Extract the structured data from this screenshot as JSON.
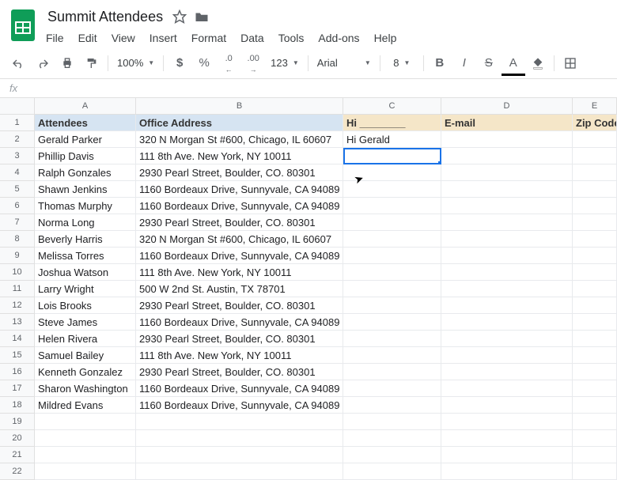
{
  "document": {
    "title": "Summit Attendees"
  },
  "menu": {
    "file": "File",
    "edit": "Edit",
    "view": "View",
    "insert": "Insert",
    "format": "Format",
    "data": "Data",
    "tools": "Tools",
    "addons": "Add-ons",
    "help": "Help"
  },
  "toolbar": {
    "zoom": "100%",
    "pct": "%",
    "dollar": "$",
    "dec_less": ".0",
    "dec_more": ".00",
    "num_format": "123",
    "font": "Arial",
    "font_size": "8",
    "bold": "B",
    "italic": "I",
    "strike": "S",
    "text_color": "A"
  },
  "formula": {
    "fx": "fx"
  },
  "columns": [
    "A",
    "B",
    "C",
    "D",
    "E"
  ],
  "headers": {
    "A": "Attendees",
    "B": "Office Address",
    "C": "Hi ________",
    "D": "E-mail",
    "E": "Zip Code"
  },
  "rows": [
    {
      "n": "1",
      "A": "Attendees",
      "B": "Office Address",
      "C": "Hi ________",
      "D": "E-mail",
      "E": "Zip Code",
      "style": "header"
    },
    {
      "n": "2",
      "A": "Gerald Parker",
      "B": "320 N Morgan St #600, Chicago, IL 60607",
      "C": "Hi Gerald",
      "D": "",
      "E": ""
    },
    {
      "n": "3",
      "A": "Phillip Davis",
      "B": "111 8th Ave. New York, NY 10011",
      "C": "",
      "D": "",
      "E": "",
      "selected": "C"
    },
    {
      "n": "4",
      "A": "Ralph Gonzales",
      "B": "2930 Pearl Street, Boulder, CO. 80301",
      "C": "",
      "D": "",
      "E": ""
    },
    {
      "n": "5",
      "A": "Shawn Jenkins",
      "B": "1160 Bordeaux Drive, Sunnyvale, CA 94089",
      "C": "",
      "D": "",
      "E": ""
    },
    {
      "n": "6",
      "A": "Thomas Murphy",
      "B": "1160 Bordeaux Drive, Sunnyvale, CA 94089",
      "C": "",
      "D": "",
      "E": ""
    },
    {
      "n": "7",
      "A": "Norma Long",
      "B": "2930 Pearl Street, Boulder, CO. 80301",
      "C": "",
      "D": "",
      "E": ""
    },
    {
      "n": "8",
      "A": "Beverly Harris",
      "B": "320 N Morgan St #600, Chicago, IL 60607",
      "C": "",
      "D": "",
      "E": ""
    },
    {
      "n": "9",
      "A": "Melissa Torres",
      "B": "1160 Bordeaux Drive, Sunnyvale, CA 94089",
      "C": "",
      "D": "",
      "E": ""
    },
    {
      "n": "10",
      "A": "Joshua Watson",
      "B": "111 8th Ave. New York, NY 10011",
      "C": "",
      "D": "",
      "E": ""
    },
    {
      "n": "11",
      "A": "Larry Wright",
      "B": "500 W 2nd St. Austin, TX 78701",
      "C": "",
      "D": "",
      "E": ""
    },
    {
      "n": "12",
      "A": "Lois Brooks",
      "B": "2930 Pearl Street, Boulder, CO. 80301",
      "C": "",
      "D": "",
      "E": ""
    },
    {
      "n": "13",
      "A": "Steve James",
      "B": "1160 Bordeaux Drive, Sunnyvale, CA 94089",
      "C": "",
      "D": "",
      "E": ""
    },
    {
      "n": "14",
      "A": "Helen Rivera",
      "B": "2930 Pearl Street, Boulder, CO. 80301",
      "C": "",
      "D": "",
      "E": ""
    },
    {
      "n": "15",
      "A": "Samuel Bailey",
      "B": "111 8th Ave. New York, NY 10011",
      "C": "",
      "D": "",
      "E": ""
    },
    {
      "n": "16",
      "A": "Kenneth Gonzalez",
      "B": "2930 Pearl Street, Boulder, CO. 80301",
      "C": "",
      "D": "",
      "E": ""
    },
    {
      "n": "17",
      "A": "Sharon Washington",
      "B": "1160 Bordeaux Drive, Sunnyvale, CA 94089",
      "C": "",
      "D": "",
      "E": ""
    },
    {
      "n": "18",
      "A": "Mildred Evans",
      "B": "1160 Bordeaux Drive, Sunnyvale, CA 94089",
      "C": "",
      "D": "",
      "E": ""
    },
    {
      "n": "19",
      "A": "",
      "B": "",
      "C": "",
      "D": "",
      "E": ""
    },
    {
      "n": "20",
      "A": "",
      "B": "",
      "C": "",
      "D": "",
      "E": ""
    },
    {
      "n": "21",
      "A": "",
      "B": "",
      "C": "",
      "D": "",
      "E": ""
    },
    {
      "n": "22",
      "A": "",
      "B": "",
      "C": "",
      "D": "",
      "E": ""
    }
  ]
}
